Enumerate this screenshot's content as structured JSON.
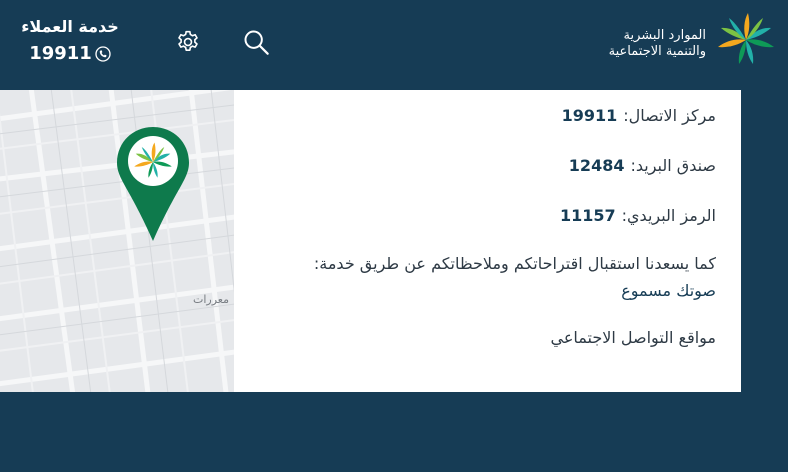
{
  "header": {
    "customer_service_title": "خدمة العملاء",
    "customer_service_number": "19911",
    "logo_line1": "الموارد البشرية",
    "logo_line2": "والتنمية الاجتماعية"
  },
  "map": {
    "place_label": "معررات"
  },
  "contact": {
    "call_center_label": "مركز الاتصال:",
    "call_center_value": "19911",
    "po_box_label": "صندق البريد:",
    "po_box_value": "12484",
    "postal_code_label": "الرمز البريدي:",
    "postal_code_value": "11157",
    "suggestions_text": "كما يسعدنا استقبال اقتراحاتكم وملاحظاتكم عن طريق خدمة:",
    "sawtak_link": "صوتك مسموع",
    "social_title": "مواقع التواصل الاجتماعي"
  },
  "colors": {
    "header_bg": "#163c55",
    "pin_green": "#0e7a4c",
    "map_bg": "#e6e8eb"
  },
  "icons": {
    "phone": "phone-icon",
    "settings": "gear-icon",
    "search": "search-icon",
    "pin": "map-pin-icon"
  }
}
